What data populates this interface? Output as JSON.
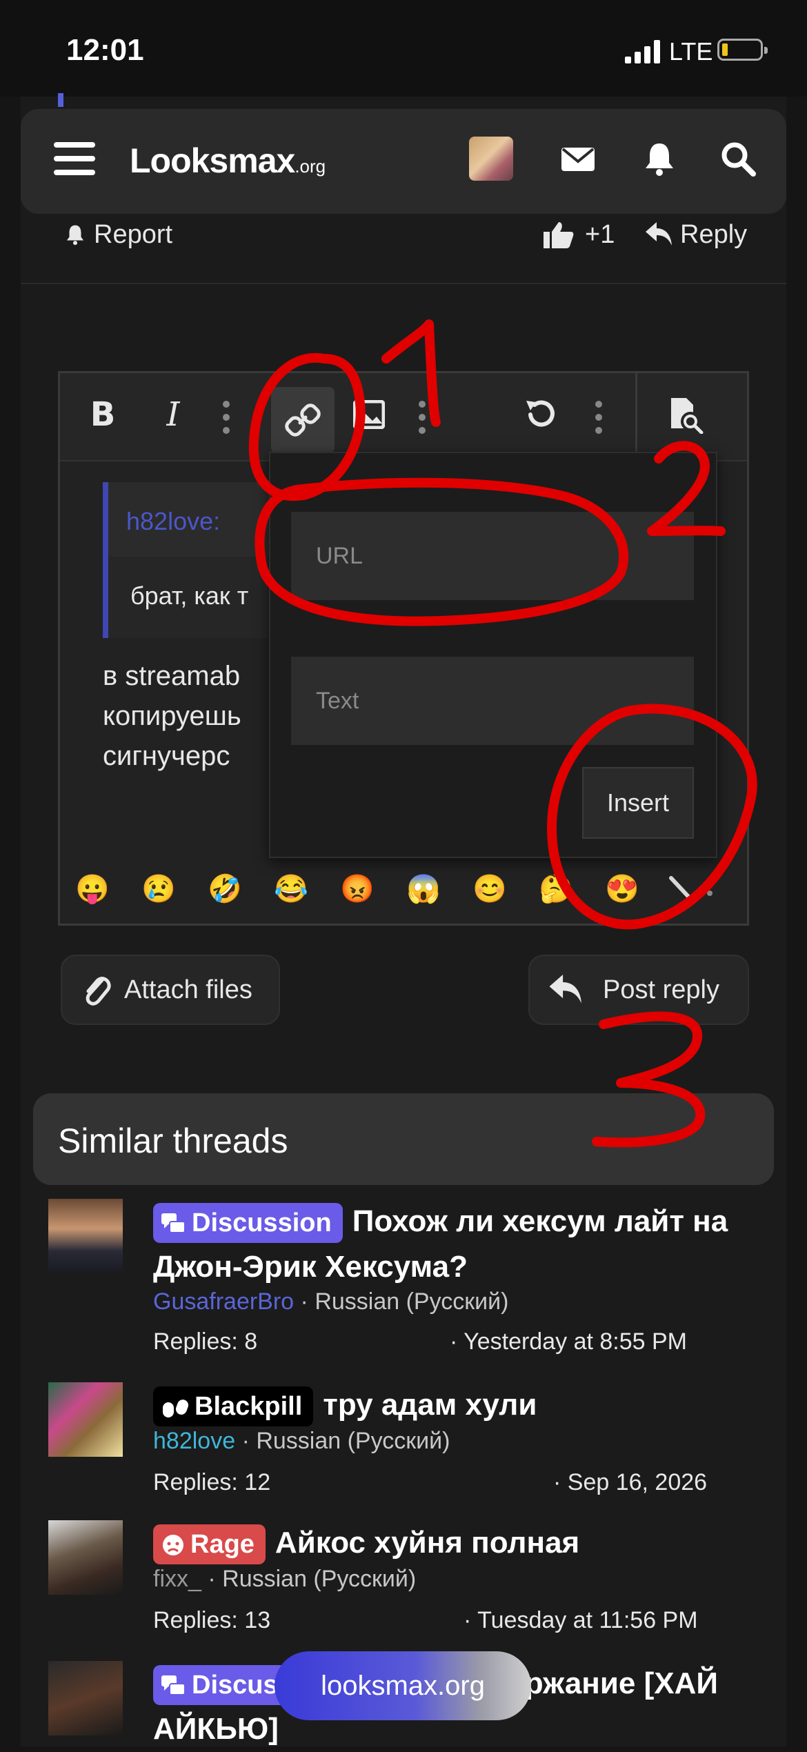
{
  "status_bar": {
    "time": "12:01",
    "network": "LTE"
  },
  "nav": {
    "logo_main": "Looksmax",
    "logo_suffix": ".org"
  },
  "post_actions": {
    "report": "Report",
    "like_count": "+1",
    "reply": "Reply"
  },
  "editor": {
    "quote_author": "h82love:",
    "quote_text": "брат, как т",
    "text_lines": [
      "в streamab",
      "копируешь",
      "сигнучерс"
    ],
    "link_popup": {
      "url_placeholder": "URL",
      "text_placeholder": "Text",
      "insert_label": "Insert"
    },
    "emojis": [
      "😛",
      "😢",
      "🤣",
      "😂",
      "😡",
      "😱",
      "😊",
      "🤔",
      "😍"
    ]
  },
  "buttons": {
    "attach": "Attach files",
    "post_reply": "Post reply"
  },
  "similar": {
    "heading": "Similar threads",
    "threads": [
      {
        "badge": "Discussion",
        "badge_color": "#6a5be8",
        "title": "Похож ли хексум лайт на Джон-Эрик Хексума?",
        "author": "GusafraerBro",
        "forum": "· Russian (Русский)",
        "replies": "Replies: 8",
        "date": "· Yesterday at 8:55 PM"
      },
      {
        "badge": "Blackpill",
        "badge_color": "#000000",
        "title": "тру адам хули",
        "author": "h82love",
        "forum": "· Russian (Русский)",
        "replies": "Replies: 12",
        "date": "· Sep 16, 2026"
      },
      {
        "badge": "Rage",
        "badge_color": "#d94a4a",
        "title": "Айкос хуйня полная",
        "author": "fixx_",
        "forum": "· Russian (Русский)",
        "replies": "Replies: 13",
        "date": "· Tuesday at 11:56 PM"
      },
      {
        "badge": "Discuss",
        "badge_color": "#6a5be8",
        "title": "воздержание [ХАЙ АЙКЬЮ]"
      }
    ]
  },
  "url_pill": "looksmax.org",
  "annotations": {
    "labels": [
      "1",
      "2",
      "3"
    ],
    "color": "#e00000"
  }
}
